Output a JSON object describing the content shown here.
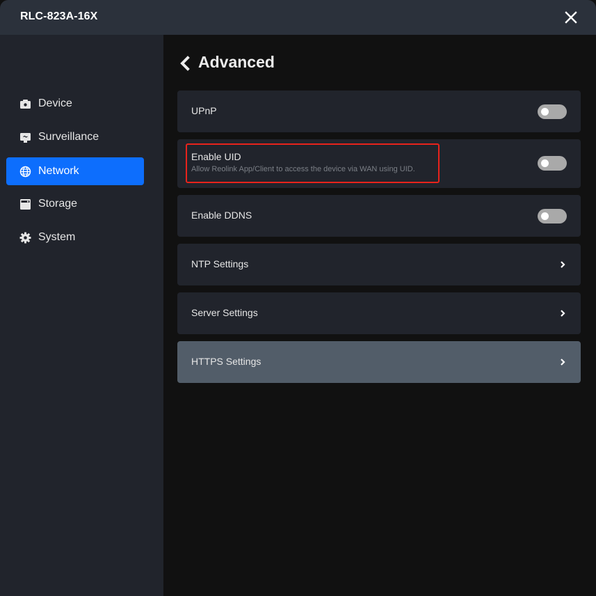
{
  "window": {
    "title": "RLC-823A-16X",
    "close_icon": "close-icon"
  },
  "sidebar": {
    "items": [
      {
        "label": "Device",
        "icon": "camera-icon",
        "active": false
      },
      {
        "label": "Surveillance",
        "icon": "monitor-icon",
        "active": false
      },
      {
        "label": "Network",
        "icon": "globe-icon",
        "active": true
      },
      {
        "label": "Storage",
        "icon": "storage-icon",
        "active": false
      },
      {
        "label": "System",
        "icon": "gear-icon",
        "active": false
      }
    ]
  },
  "main": {
    "back_icon": "chevron-left-icon",
    "title": "Advanced",
    "rows": [
      {
        "label": "UPnP",
        "type": "toggle",
        "enabled": false
      },
      {
        "label": "Enable UID",
        "description": "Allow Reolink App/Client to access the device via WAN using UID.",
        "type": "toggle",
        "enabled": false,
        "annotated": true
      },
      {
        "label": "Enable DDNS",
        "type": "toggle",
        "enabled": false
      },
      {
        "label": "NTP Settings",
        "type": "link"
      },
      {
        "label": "Server Settings",
        "type": "link"
      },
      {
        "label": "HTTPS Settings",
        "type": "link",
        "hovered": true
      }
    ]
  },
  "colors": {
    "accent": "#0d6efd",
    "annotation": "#e8231c",
    "toggle_off": "#a9a9a9",
    "row_bg": "#21242c",
    "row_hover_bg": "#525d69"
  }
}
